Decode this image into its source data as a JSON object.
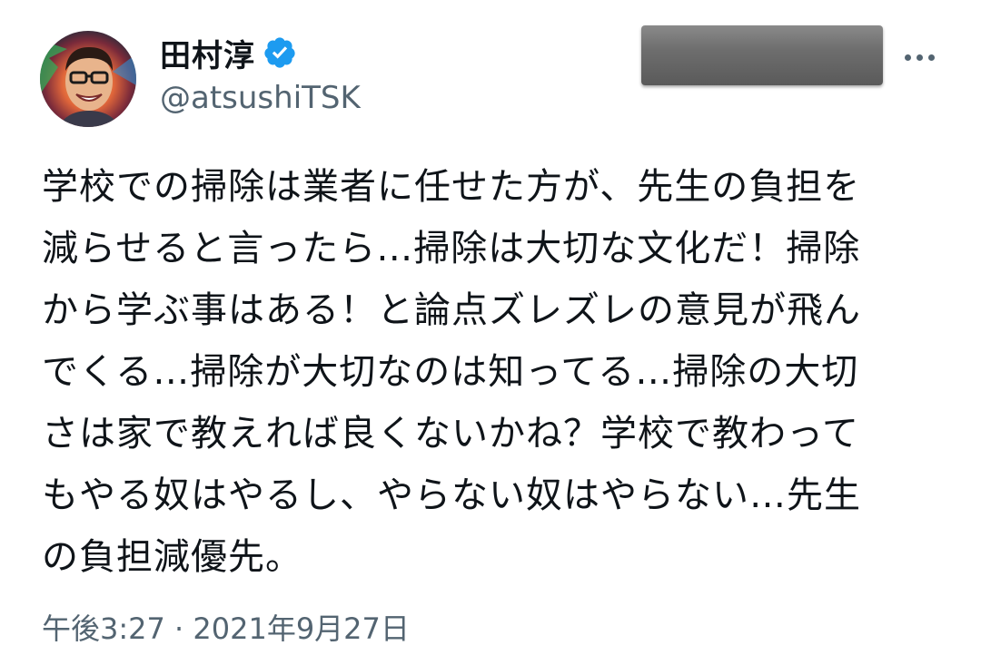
{
  "author": {
    "display_name": "田村淳",
    "handle": "@atsushiTSK",
    "verified": true,
    "avatar_icon": "profile-photo"
  },
  "header": {
    "more_icon": "more-horizontal-icon"
  },
  "tweet": {
    "lines": [
      "学校での掃除は業者に任せた方が、先生の負担を",
      "減らせると言ったら…掃除は大切な文化だ！掃除",
      "から学ぶ事はある！と論点ズレズレの意見が飛ん",
      "でくる…掃除が大切なのは知ってる…掃除の大切",
      "さは家で教えれば良くないかね？学校で教わって",
      "もやる奴はやるし、やらない奴はやらない…先生",
      "の負担減優先。"
    ],
    "timestamp": "午後3:27 · 2021年9月27日"
  },
  "colors": {
    "text_primary": "#0f1419",
    "text_secondary": "#536471",
    "verified_badge": "#1d9bf0",
    "redaction": "#6e6e6e"
  }
}
